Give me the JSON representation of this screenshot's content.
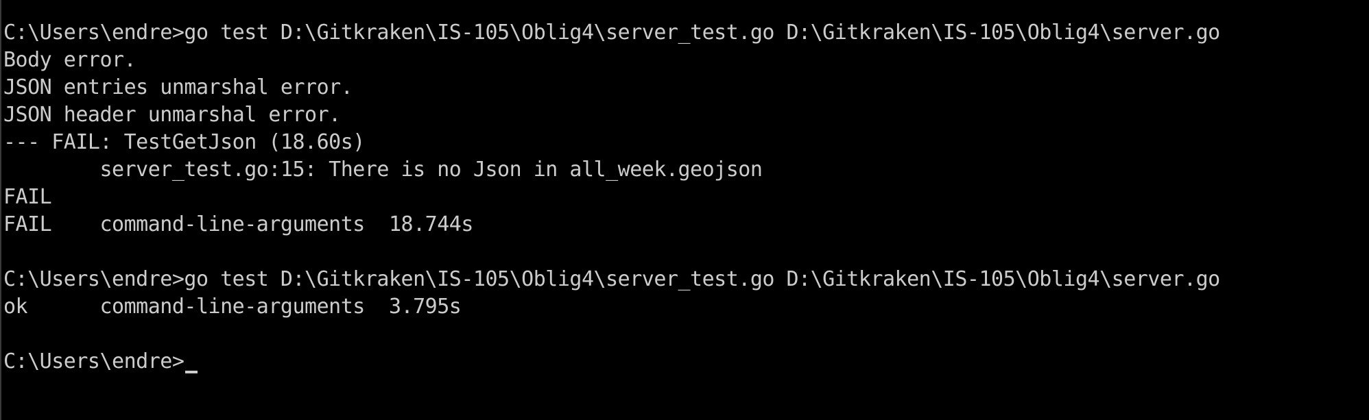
{
  "console": {
    "colors": {
      "background": "#000000",
      "foreground": "#cccccc"
    },
    "lines": [
      "C:\\Users\\endre>go test D:\\Gitkraken\\IS-105\\Oblig4\\server_test.go D:\\Gitkraken\\IS-105\\Oblig4\\server.go",
      "Body error.",
      "JSON entries unmarshal error.",
      "JSON header unmarshal error.",
      "--- FAIL: TestGetJson (18.60s)",
      "        server_test.go:15: There is no Json in all_week.geojson",
      "FAIL",
      "FAIL    command-line-arguments  18.744s",
      "",
      "C:\\Users\\endre>go test D:\\Gitkraken\\IS-105\\Oblig4\\server_test.go D:\\Gitkraken\\IS-105\\Oblig4\\server.go",
      "ok      command-line-arguments  3.795s",
      "",
      "C:\\Users\\endre>"
    ]
  }
}
